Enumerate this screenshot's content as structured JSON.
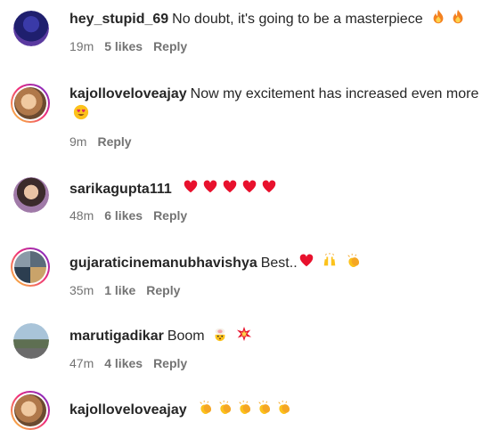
{
  "comments": [
    {
      "username": "hey_stupid_69",
      "text": "No doubt, it's going to be a masterpiece",
      "emojis": [
        "fire-icon",
        "fire-icon"
      ],
      "time": "19m",
      "likes": "5 likes",
      "reply": "Reply"
    },
    {
      "username": "kajolloveloveajay",
      "text": "Now my excitement has increased even more",
      "emojis": [
        "heart-eyes-icon"
      ],
      "time": "9m",
      "likes": "",
      "reply": "Reply"
    },
    {
      "username": "sarikagupta111",
      "text": "",
      "emojis": [
        "red-heart-icon",
        "red-heart-icon",
        "red-heart-icon",
        "red-heart-icon",
        "red-heart-icon"
      ],
      "time": "48m",
      "likes": "6 likes",
      "reply": "Reply"
    },
    {
      "username": "gujaraticinemanubhavishya",
      "text": "Best..",
      "emojis": [
        "red-heart-icon",
        "raising-hands-icon",
        "clapping-hands-icon"
      ],
      "time": "35m",
      "likes": "1 like",
      "reply": "Reply"
    },
    {
      "username": "marutigadikar",
      "text": "Boom",
      "emojis": [
        "exploding-head-icon",
        "collision-icon"
      ],
      "time": "47m",
      "likes": "4 likes",
      "reply": "Reply"
    },
    {
      "username": "kajolloveloveajay",
      "text": "",
      "emojis": [
        "clapping-hands-icon",
        "clapping-hands-icon",
        "clapping-hands-icon",
        "clapping-hands-icon",
        "clapping-hands-icon"
      ],
      "time": "",
      "likes": "",
      "reply": ""
    }
  ],
  "colors": {
    "text": "#262626",
    "meta": "#737373",
    "story_ring_start": "#f9ce34",
    "story_ring_mid": "#ee2a7b",
    "story_ring_end": "#6228d7"
  }
}
